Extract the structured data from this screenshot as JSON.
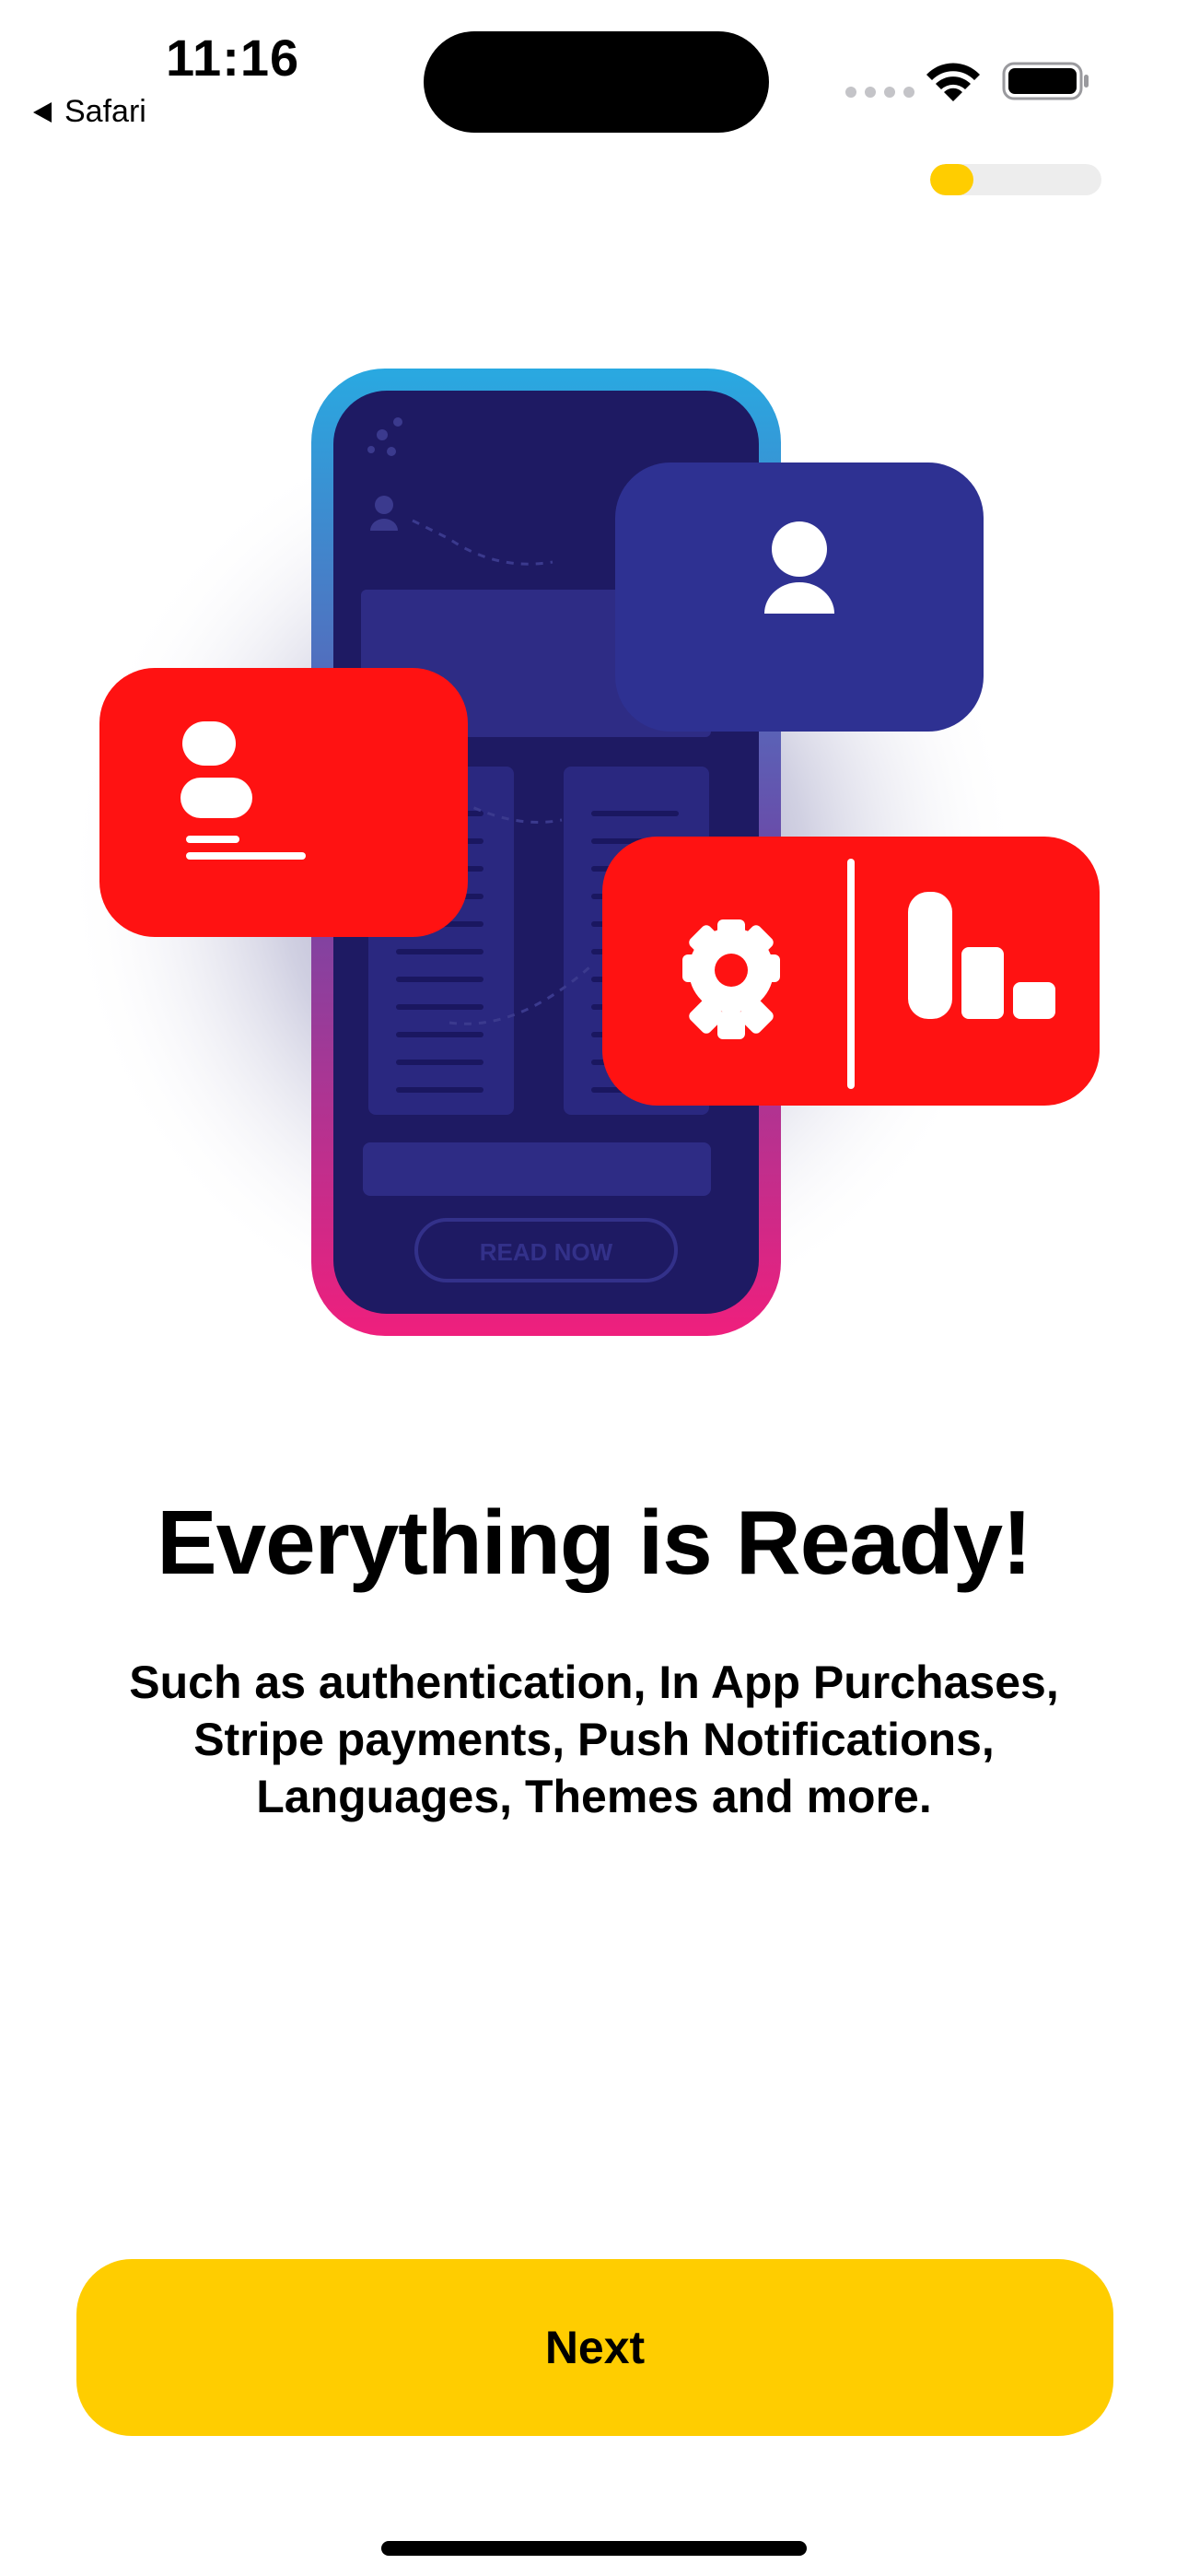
{
  "status_bar": {
    "time": "11:16",
    "back_label": "Safari"
  },
  "onboarding": {
    "progress": 0.25,
    "progress_color": "#ffcd00",
    "illustration": {
      "phone_button_label": "READ NOW",
      "card_colors": {
        "red": "#ff1212",
        "navy": "#2e3192"
      },
      "icons": [
        "user-icon",
        "profile-card-icon",
        "gear-icon",
        "bar-chart-icon"
      ]
    },
    "title": "Everything is Ready!",
    "description": "Such as authentication, In App Purchases, Stripe payments, Push Notifications, Languages, Themes and more.",
    "next_label": "Next"
  }
}
